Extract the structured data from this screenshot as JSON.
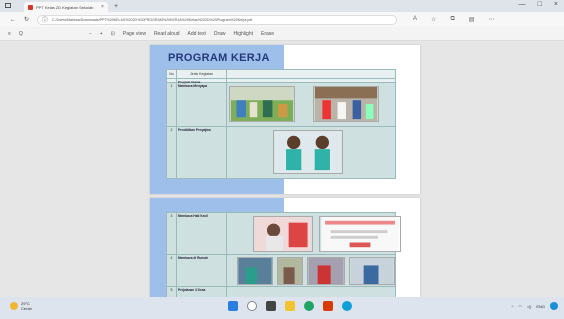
{
  "browser": {
    "tab_title": "PPT Kelas 2D Kegiatan Sekolah",
    "tab_close": "×",
    "new_tab": "+",
    "url": "C:/Users/Mahesa/Downloads/PPT%20KELAS%202D%20PROGRAM%20KERJA%20Kelas%202D%20Program%20Kerja.pdf",
    "nav": {
      "back": "←",
      "forward": "→",
      "refresh": "↻"
    },
    "win": {
      "min": "—",
      "max": "□",
      "close": "×"
    }
  },
  "pdf_toolbar": {
    "contents": "≡",
    "search": "Q",
    "zoom_out": "−",
    "zoom_in": "+",
    "fit": "⊡",
    "page_view": "Page view",
    "read_aloud": "Read aloud",
    "add_text": "Add text",
    "draw": "Draw",
    "highlight": "Highlight",
    "erase": "Erase"
  },
  "document": {
    "title": "PROGRAM KERJA",
    "table_headers": {
      "no": "No",
      "kegiatan": "Jenis Kegiatan"
    },
    "section_label": "Program Utama",
    "rows": [
      {
        "no": "1",
        "label": "Membaca Menyapa"
      },
      {
        "no": "2",
        "label": "Pendidikan Penyajian"
      },
      {
        "no": "3",
        "label": "Membaca Hati Kecil"
      },
      {
        "no": "4",
        "label": "Membaca di Rumah"
      },
      {
        "no": "5",
        "label": "Perjalanan 3 Desa"
      }
    ]
  },
  "taskbar": {
    "weather_temp": "29°C",
    "weather_desc": "Cerah",
    "tray_text": "ENG"
  }
}
